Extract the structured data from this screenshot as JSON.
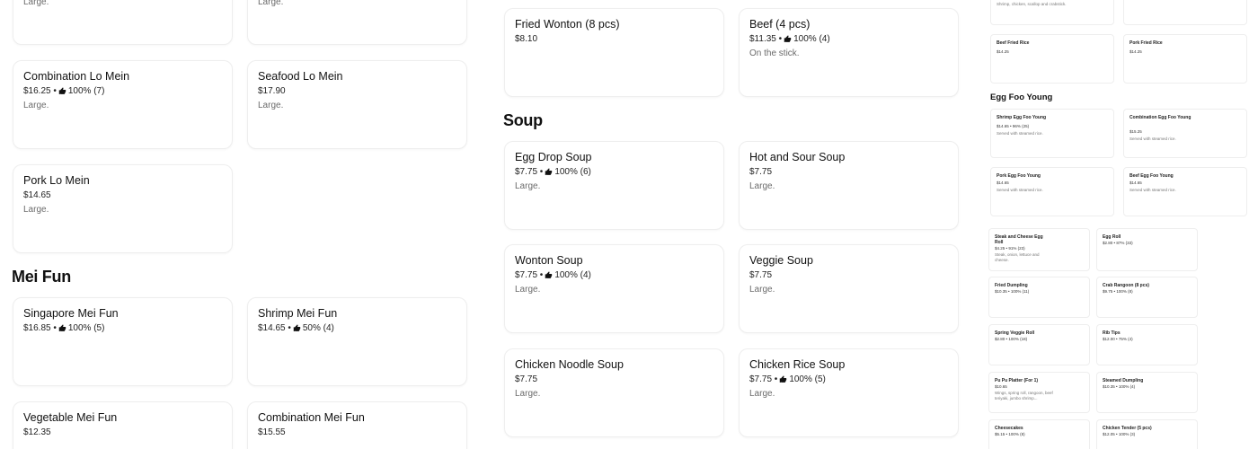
{
  "left_top": {
    "card1_desc": "Large.",
    "card2_desc": "Large."
  },
  "lo_mein": [
    {
      "name": "Combination Lo Mein",
      "price": "$16.25",
      "rating": "100% (7)",
      "desc": "Large."
    },
    {
      "name": "Seafood Lo Mein",
      "price": "$17.90",
      "rating": "",
      "desc": "Large."
    },
    {
      "name": "Pork Lo Mein",
      "price": "$14.65",
      "rating": "",
      "desc": "Large."
    }
  ],
  "mei_fun": {
    "title": "Mei Fun",
    "items": [
      {
        "name": "Singapore Mei Fun",
        "price": "$16.85",
        "rating": "100% (5)",
        "desc": ""
      },
      {
        "name": "Shrimp Mei Fun",
        "price": "$14.65",
        "rating": "50% (4)",
        "desc": ""
      },
      {
        "name": "Vegetable Mei Fun",
        "price": "$12.35",
        "rating": "",
        "desc": ""
      },
      {
        "name": "Combination Mei Fun",
        "price": "$15.55",
        "rating": "",
        "desc": ""
      }
    ]
  },
  "middle_top": [
    {
      "name": "Fried Wonton (8 pcs)",
      "price": "$8.10",
      "rating": "",
      "desc": ""
    },
    {
      "name": "Beef (4 pcs)",
      "price": "$11.35",
      "rating": "100% (4)",
      "desc": "On the stick."
    }
  ],
  "soup": {
    "title": "Soup",
    "items": [
      {
        "name": "Egg Drop Soup",
        "price": "$7.75",
        "rating": "100% (6)",
        "desc": "Large."
      },
      {
        "name": "Hot and Sour Soup",
        "price": "$7.75",
        "rating": "",
        "desc": "Large."
      },
      {
        "name": "Wonton Soup",
        "price": "$7.75",
        "rating": "100% (4)",
        "desc": "Large."
      },
      {
        "name": "Veggie Soup",
        "price": "$7.75",
        "rating": "",
        "desc": "Large."
      },
      {
        "name": "Chicken Noodle Soup",
        "price": "$7.75",
        "rating": "",
        "desc": "Large."
      },
      {
        "name": "Chicken Rice Soup",
        "price": "$7.75",
        "rating": "100% (5)",
        "desc": "Large."
      }
    ]
  },
  "mini": {
    "top_desc": "Shrimp, chicken, scallop and crabstick.",
    "fried_rice": [
      {
        "name": "Beef Fried Rice",
        "price": "$14.25"
      },
      {
        "name": "Pork Fried Rice",
        "price": "$14.25"
      }
    ],
    "egg_foo_title": "Egg Foo Young",
    "egg_foo": [
      {
        "name": "Shrimp Egg Foo Young",
        "meta": "$14.65 • 96% (25)",
        "desc": "Served with steamed rice."
      },
      {
        "name": "Combination Egg Foo Young",
        "meta": "$15.25",
        "desc": "Served with steamed rice."
      },
      {
        "name": "Pork Egg Foo Young",
        "meta": "$14.65",
        "desc": "Served with steamed rice."
      },
      {
        "name": "Beef Egg Foo Young",
        "meta": "$14.65",
        "desc": "Served with steamed rice."
      }
    ],
    "apps": [
      {
        "name": "Steak and Cheese Egg Roll",
        "meta": "$4.25 • 91% (23)",
        "desc": "Steak, onion, lettuce and cheese."
      },
      {
        "name": "Egg Roll",
        "meta": "$2.80 • 87% (33)",
        "desc": ""
      },
      {
        "name": "Fried Dumpling",
        "meta": "$10.35 • 100% (11)",
        "desc": ""
      },
      {
        "name": "Crab Rangoon (8 pcs)",
        "meta": "$9.75 • 100% (8)",
        "desc": ""
      },
      {
        "name": "Spring Veggie Roll",
        "meta": "$2.80 • 100% (18)",
        "desc": ""
      },
      {
        "name": "Rib Tips",
        "meta": "$12.00 • 75% (4)",
        "desc": ""
      },
      {
        "name": "Pu Pu Platter (For 1)",
        "meta": "$10.65",
        "desc": "Wings, spring roll, rangoon, beef teriyaki, jumbo shrimp..."
      },
      {
        "name": "Steamed Dumpling",
        "meta": "$10.35 • 100% (4)",
        "desc": ""
      },
      {
        "name": "Cheesecakes",
        "meta": "$5.15 • 100% (8)",
        "desc": ""
      },
      {
        "name": "Chicken Tender (5 pcs)",
        "meta": "$12.05 • 100% (3)",
        "desc": ""
      }
    ]
  }
}
